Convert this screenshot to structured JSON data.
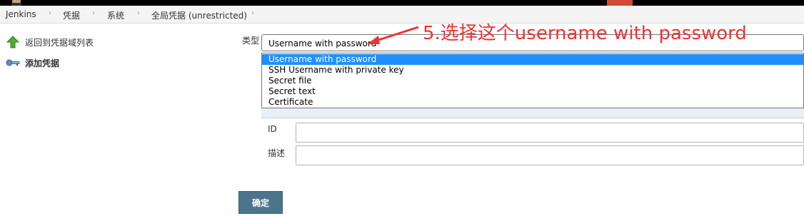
{
  "breadcrumb": {
    "items": [
      "Jenkins",
      "凭据",
      "系统",
      "全局凭据 (unrestricted)"
    ],
    "separator": "›"
  },
  "sidebar": {
    "items": [
      {
        "label": "返回到凭据域列表",
        "icon": "up-arrow-icon"
      },
      {
        "label": "添加凭据",
        "icon": "key-icon"
      }
    ]
  },
  "form": {
    "type_label": "类型",
    "type_value": "Username with password",
    "options": [
      "Username with password",
      "SSH Username with private key",
      "Secret file",
      "Secret text",
      "Certificate"
    ],
    "id_label": "ID",
    "desc_label": "描述",
    "submit_label": "确定"
  },
  "annotation": {
    "text": "5.选择这个username with password",
    "color": "#f03232"
  },
  "colors": {
    "selected": "#1e90ff",
    "button": "#4b758b",
    "topbar": "#000000",
    "topbar_accent": "#d24939"
  }
}
